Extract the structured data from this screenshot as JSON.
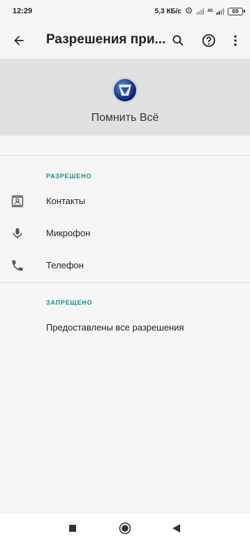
{
  "status_bar": {
    "time": "12:29",
    "speed": "5,3 КБ/с",
    "network_tag": "4G",
    "battery": "69"
  },
  "toolbar": {
    "title": "Разрешения при...",
    "back_icon": "arrow-back-icon",
    "search_icon": "search-icon",
    "help_icon": "help-icon",
    "more_icon": "more-vert-icon"
  },
  "app": {
    "name": "Помнить Всё",
    "icon": "app-logo-icon"
  },
  "allowed": {
    "heading": "РАЗРЕШЕНО",
    "items": [
      {
        "label": "Контакты",
        "icon": "contacts-icon"
      },
      {
        "label": "Микрофон",
        "icon": "microphone-icon"
      },
      {
        "label": "Телефон",
        "icon": "phone-icon"
      }
    ]
  },
  "denied": {
    "heading": "ЗАПРЕЩЕНО",
    "message": "Предоставлены все разрешения"
  },
  "colors": {
    "accent": "#1b8a8a",
    "header_bg": "#e1e1e1",
    "page_bg": "#f6f6f6"
  },
  "nav_bar": {
    "recents_icon": "square-recents-icon",
    "home_icon": "circle-home-icon",
    "back_icon": "triangle-back-icon"
  }
}
